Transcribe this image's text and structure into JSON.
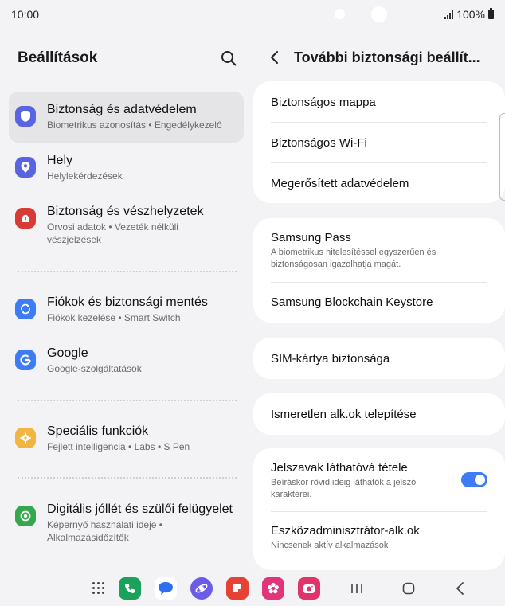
{
  "status_bar": {
    "time": "10:00",
    "battery": "100%"
  },
  "left": {
    "title": "Beállítások",
    "items": [
      {
        "title": "Biztonság és adatvédelem",
        "subtitle": "Biometrikus azonosítás  •  Engedélykezelő",
        "icon": "shield-icon",
        "color": "#5b64e0",
        "selected": true
      },
      {
        "title": "Hely",
        "subtitle": "Helylekérdezések",
        "icon": "location-pin-icon",
        "color": "#5b64e0"
      },
      {
        "title": "Biztonság és vészhelyzetek",
        "subtitle": "Orvosi adatok  •  Vezeték nélküli vészjelzések",
        "icon": "emergency-icon",
        "color": "#d63b36"
      },
      {
        "title": "Fiókok és biztonsági mentés",
        "subtitle": "Fiókok kezelése  •  Smart Switch",
        "icon": "sync-icon",
        "color": "#3e7bf7"
      },
      {
        "title": "Google",
        "subtitle": "Google-szolgáltatások",
        "icon": "google-icon",
        "color": "#3e7bf7"
      },
      {
        "title": "Speciális funkciók",
        "subtitle": "Fejlett intelligencia  •  Labs  •  S Pen",
        "icon": "advanced-features-icon",
        "color": "#f3b541"
      },
      {
        "title": "Digitális jóllét és szülői felügyelet",
        "subtitle": "Képernyő használati ideje  •  Alkalmazásidőzítők",
        "icon": "wellbeing-icon",
        "color": "#36a64f"
      }
    ]
  },
  "right": {
    "title": "További biztonsági beállít...",
    "cards": [
      {
        "rows": [
          {
            "title": "Biztonságos mappa"
          },
          {
            "title": "Biztonságos Wi-Fi"
          },
          {
            "title": "Megerősített adatvédelem"
          }
        ]
      },
      {
        "rows": [
          {
            "title": "Samsung Pass",
            "subtitle": "A biometrikus hitelesítéssel egyszerűen és biztonságosan igazolhatja magát."
          },
          {
            "title": "Samsung Blockchain Keystore"
          }
        ]
      },
      {
        "rows": [
          {
            "title": "SIM-kártya biztonsága"
          }
        ]
      },
      {
        "rows": [
          {
            "title": "Ismeretlen alk.ok telepítése"
          }
        ]
      },
      {
        "rows": [
          {
            "title": "Jelszavak láthatóvá tétele",
            "subtitle": "Beíráskor rövid ideig láthatók a jelszó karakterei.",
            "toggle": true
          },
          {
            "title": "Eszközadminisztrátor-alk.ok",
            "subtitle": "Nincsenek aktív alkalmazások"
          }
        ]
      }
    ]
  },
  "dock": [
    {
      "icon": "phone-icon",
      "color": "#1aa25a"
    },
    {
      "icon": "messages-icon",
      "color": "#2f6ef0"
    },
    {
      "icon": "internet-icon",
      "color": "#6b5ce7"
    },
    {
      "icon": "notes-icon",
      "color": "#e34234"
    },
    {
      "icon": "gallery-icon",
      "color": "#e0357a"
    },
    {
      "icon": "camera-icon",
      "color": "#e0356a"
    }
  ],
  "accent": "#3e7bf7"
}
